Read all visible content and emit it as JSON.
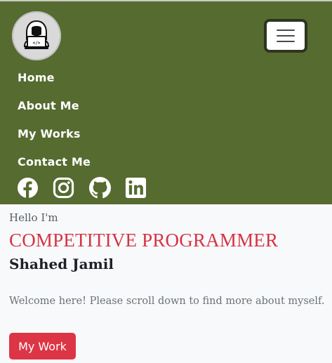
{
  "nav": {
    "logo_icon": "hacker-laptop-avatar-icon",
    "toggler_icon": "hamburger-menu-icon",
    "links": [
      "Home",
      "About Me",
      "My Works",
      "Contact Me"
    ],
    "social": [
      {
        "icon": "facebook-icon"
      },
      {
        "icon": "instagram-icon"
      },
      {
        "icon": "github-icon"
      },
      {
        "icon": "linkedin-icon"
      }
    ]
  },
  "hero": {
    "greeting": "Hello I'm",
    "role": "COMPETITIVE PROGRAMMER",
    "name": "Shahed Jamil",
    "welcome": "Welcome here! Please scroll down to find more about myself.",
    "cta_label": "My Work"
  },
  "colors": {
    "navbar_bg": "#566b30",
    "accent_red": "#dc3545",
    "page_bg": "#f8f9fa"
  }
}
